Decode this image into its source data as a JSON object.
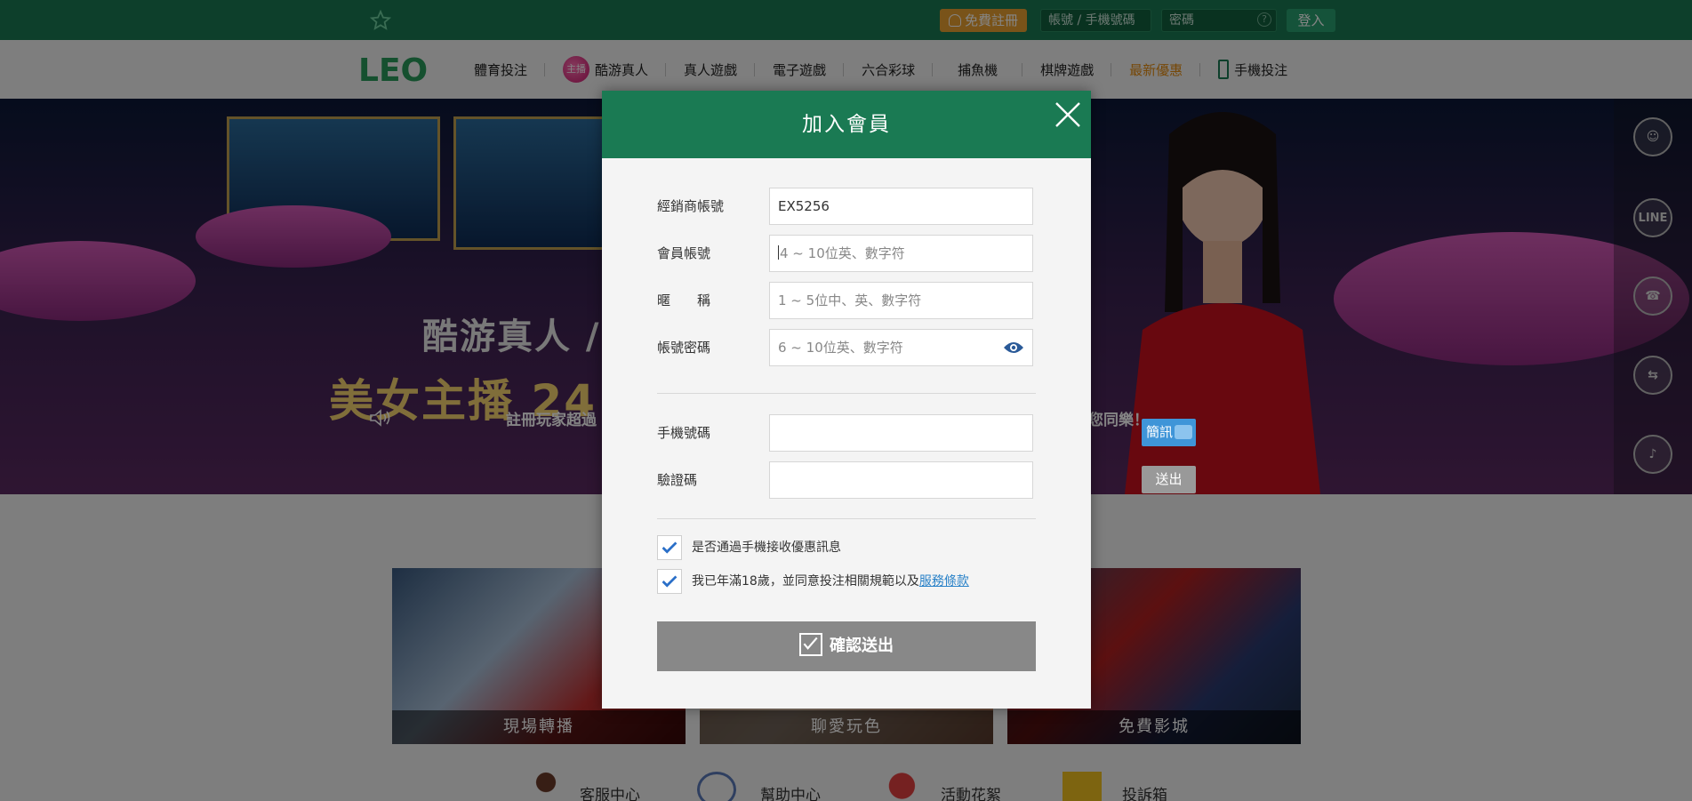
{
  "topbar": {
    "register_label": "免費註冊",
    "account_placeholder": "帳號 / 手機號碼",
    "password_placeholder": "密碼",
    "password_help": "?",
    "login_label": "登入"
  },
  "nav": {
    "logo_text": "LEO",
    "host_badge": "主播",
    "items": [
      "體育投注",
      "酷游真人",
      "真人遊戲",
      "電子遊戲",
      "六合彩球",
      "捕魚機",
      "棋牌遊戲",
      "最新優惠",
      "手機投注"
    ]
  },
  "banner": {
    "headline_1": "酷游真人 /",
    "headline_2": "美女主播 24",
    "ticker_left": "註冊玩家超過",
    "ticker_right": "您同樂！"
  },
  "sidebar": {
    "line_label": "LINE"
  },
  "cards": [
    "現場轉播",
    "聊愛玩色",
    "免費影城"
  ],
  "bottom_links": [
    "客服中心",
    "幫助中心",
    "活動花絮",
    "投訴箱"
  ],
  "modal": {
    "title": "加入會員",
    "fields": {
      "agent_label": "經銷商帳號",
      "agent_value": "EX5256",
      "member_label": "會員帳號",
      "member_placeholder": "4 ~ 10位英、數字符",
      "nickname_label": "暱　　稱",
      "nickname_placeholder": "1 ~ 5位中、英、數字符",
      "password_label": "帳號密碼",
      "password_placeholder": "6 ~ 10位英、數字符",
      "phone_label": "手機號碼",
      "sms_button": "簡訊",
      "code_label": "驗證碼",
      "send_button": "送出"
    },
    "checks": {
      "promo_label": "是否通過手機接收優惠訊息",
      "agree_prefix": "我已年滿18歲，並同意投注相關規範以及",
      "terms_link": "服務條款"
    },
    "submit_label": "確認送出"
  },
  "colors": {
    "brand_green": "#1a7a53",
    "register_orange": "#e8a030",
    "promo_orange": "#e38a10",
    "sms_blue": "#3f95d8",
    "check_blue": "#2a6fc8"
  }
}
